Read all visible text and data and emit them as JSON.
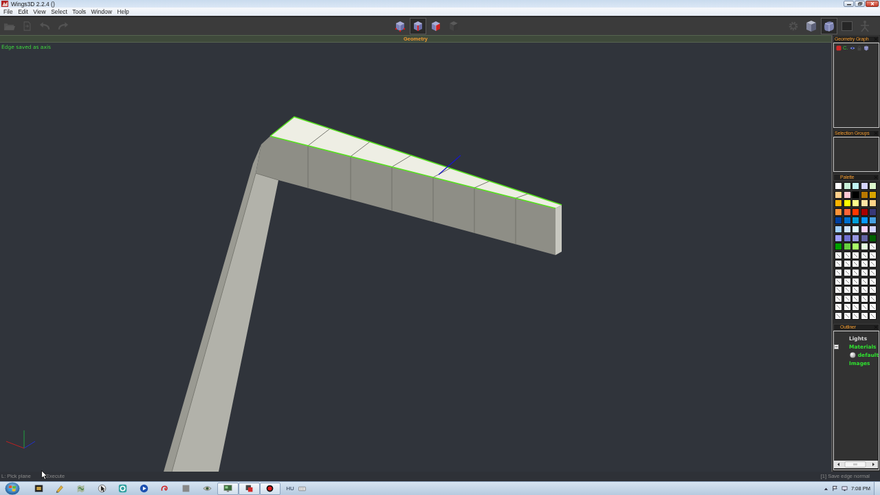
{
  "window": {
    "title": "Wings3D 2.2.4 ()"
  },
  "menu": [
    "File",
    "Edit",
    "View",
    "Select",
    "Tools",
    "Window",
    "Help"
  ],
  "toolbar": {
    "file_buttons": [
      {
        "kind": "open",
        "disabled": true
      },
      {
        "kind": "save",
        "disabled": true
      },
      {
        "kind": "undo",
        "disabled": true
      },
      {
        "kind": "redo",
        "disabled": true
      }
    ],
    "select_modes": [
      {
        "kind": "vertex",
        "selected": false
      },
      {
        "kind": "edge",
        "selected": true
      },
      {
        "kind": "face",
        "selected": false
      },
      {
        "kind": "body",
        "selected": false
      }
    ],
    "view_buttons": [
      {
        "kind": "gear",
        "selected": false,
        "disabled": true
      },
      {
        "kind": "cube",
        "selected": false,
        "disabled": false
      },
      {
        "kind": "smooth",
        "selected": true,
        "disabled": false
      },
      {
        "kind": "blank",
        "selected": false,
        "disabled": false
      },
      {
        "kind": "figure",
        "selected": false,
        "disabled": true
      }
    ]
  },
  "viewport": {
    "title": "Geometry",
    "message": "Edge saved as axis"
  },
  "panels": {
    "geometry_graph": {
      "title": "Geometry Graph",
      "object_name": "C."
    },
    "selection_groups": {
      "title": "Selection Groups"
    },
    "palette": {
      "title": "Palette",
      "swatches": [
        {
          "kind": "color",
          "color": "#ffffff"
        },
        {
          "kind": "color",
          "color": "#c8f0d8"
        },
        {
          "kind": "color",
          "color": "#c0f4f4"
        },
        {
          "kind": "color",
          "color": "#d4d4fc"
        },
        {
          "kind": "color",
          "color": "#dcf8cc"
        },
        {
          "kind": "color",
          "color": "#ffd08c"
        },
        {
          "kind": "color",
          "color": "#ffc8d4"
        },
        {
          "kind": "color",
          "color": "#000000"
        },
        {
          "kind": "color",
          "color": "#b87800"
        },
        {
          "kind": "color",
          "color": "#d8a400"
        },
        {
          "kind": "color",
          "color": "#ffb400"
        },
        {
          "kind": "color",
          "color": "#ffff00"
        },
        {
          "kind": "color",
          "color": "#ffff8c"
        },
        {
          "kind": "color",
          "color": "#ffe4a4"
        },
        {
          "kind": "color",
          "color": "#ffd488"
        },
        {
          "kind": "color",
          "color": "#ff9438"
        },
        {
          "kind": "color",
          "color": "#ff6438"
        },
        {
          "kind": "color",
          "color": "#ff3800"
        },
        {
          "kind": "color",
          "color": "#a80000"
        },
        {
          "kind": "color",
          "color": "#383878"
        },
        {
          "kind": "color",
          "color": "#0040a0"
        },
        {
          "kind": "color",
          "color": "#0070d0"
        },
        {
          "kind": "color",
          "color": "#00a0d8"
        },
        {
          "kind": "color",
          "color": "#0898ff"
        },
        {
          "kind": "color",
          "color": "#48a0e0"
        },
        {
          "kind": "color",
          "color": "#a0d0ff"
        },
        {
          "kind": "color",
          "color": "#d0e4ff"
        },
        {
          "kind": "color",
          "color": "#e0fcff"
        },
        {
          "kind": "color",
          "color": "#fcd4fc"
        },
        {
          "kind": "color",
          "color": "#d4d4ff"
        },
        {
          "kind": "color",
          "color": "#a0a0ff"
        },
        {
          "kind": "color",
          "color": "#7070d0"
        },
        {
          "kind": "color",
          "color": "#9898e0"
        },
        {
          "kind": "color",
          "color": "#6464a4"
        },
        {
          "kind": "color",
          "color": "#006000"
        },
        {
          "kind": "color",
          "color": "#00a000"
        },
        {
          "kind": "color",
          "color": "#68d040"
        },
        {
          "kind": "color",
          "color": "#a8ff68"
        },
        {
          "kind": "color",
          "color": "#e4ffe0"
        },
        {
          "kind": "empty"
        },
        {
          "kind": "empty"
        },
        {
          "kind": "empty"
        },
        {
          "kind": "empty"
        },
        {
          "kind": "empty"
        },
        {
          "kind": "empty"
        },
        {
          "kind": "empty"
        },
        {
          "kind": "empty"
        },
        {
          "kind": "empty"
        },
        {
          "kind": "empty"
        },
        {
          "kind": "empty"
        },
        {
          "kind": "empty"
        },
        {
          "kind": "empty"
        },
        {
          "kind": "empty"
        },
        {
          "kind": "empty"
        },
        {
          "kind": "empty"
        },
        {
          "kind": "empty"
        },
        {
          "kind": "empty"
        },
        {
          "kind": "empty"
        },
        {
          "kind": "empty"
        },
        {
          "kind": "empty"
        },
        {
          "kind": "empty"
        },
        {
          "kind": "empty"
        },
        {
          "kind": "empty"
        },
        {
          "kind": "empty"
        },
        {
          "kind": "empty"
        },
        {
          "kind": "empty"
        },
        {
          "kind": "empty"
        },
        {
          "kind": "empty"
        },
        {
          "kind": "empty"
        },
        {
          "kind": "empty"
        },
        {
          "kind": "empty"
        },
        {
          "kind": "empty"
        },
        {
          "kind": "empty"
        },
        {
          "kind": "empty"
        },
        {
          "kind": "empty"
        },
        {
          "kind": "empty"
        },
        {
          "kind": "empty"
        },
        {
          "kind": "empty"
        },
        {
          "kind": "empty"
        },
        {
          "kind": "empty"
        }
      ]
    },
    "outliner": {
      "title": "Outliner",
      "items": [
        {
          "label": "Lights",
          "color": "#d8d8d8"
        },
        {
          "label": "Materials",
          "color": "#30e030",
          "expanded": true,
          "children": [
            {
              "label": "default",
              "color": "#30e030",
              "kind": "material"
            }
          ]
        },
        {
          "label": "Images",
          "color": "#30e030"
        }
      ]
    }
  },
  "status_bar": {
    "left": [
      "L: Pick plane",
      "Execute"
    ],
    "right": "[1] Save edge normal"
  },
  "taskbar": {
    "apps": [
      {
        "kind": "film",
        "running": false
      },
      {
        "kind": "pencil",
        "running": false
      },
      {
        "kind": "map",
        "running": false
      },
      {
        "kind": "cursor",
        "running": false
      },
      {
        "kind": "ring",
        "running": false
      },
      {
        "kind": "play",
        "running": false
      },
      {
        "kind": "swirl",
        "running": false
      },
      {
        "kind": "square",
        "running": false
      },
      {
        "kind": "eye",
        "running": false
      },
      {
        "kind": "monitor",
        "running": true
      },
      {
        "kind": "logo",
        "running": true
      },
      {
        "kind": "record",
        "running": true
      }
    ],
    "language": "HU",
    "clock": "7:08 PM"
  }
}
